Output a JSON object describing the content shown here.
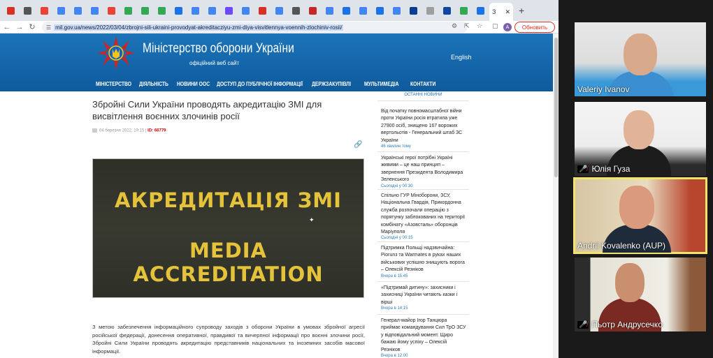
{
  "browser": {
    "active_tab_label": "З",
    "url": "mil.gov.ua/news/2022/03/04/zbrojni-sili-ukraini-provodyat-akreditacziyu-zmi-diya-visvitlennya-voennih-zlochiniv-rosii/",
    "update_button": "Обновить",
    "profile_letter": "A",
    "tab_favicons": [
      "#d93025",
      "#555",
      "#ea4335",
      "#4285f4",
      "#4285f4",
      "#4285f4",
      "#ea4335",
      "#34a853",
      "#34a853",
      "#34a853",
      "#1a73e8",
      "#4285f4",
      "#4285f4",
      "#6d4aff",
      "#4285f4",
      "#d93025",
      "#4285f4",
      "#555",
      "#c62828",
      "#4285f4",
      "#1a73e8",
      "#4285f4",
      "#1a73e8",
      "#4285f4",
      "#0b3d91",
      "#9e9e9e",
      "#0d47a1",
      "#34a853",
      "#1a73e8"
    ]
  },
  "site": {
    "title": "Міністерство оборони України",
    "subtitle": "офіційний веб сайт",
    "language": "English",
    "nav": [
      "МІНІСТЕРСТВО",
      "ДІЯЛЬНІСТЬ",
      "НОВИНИ ООС",
      "ДОСТУП ДО ПУБЛІЧНОЇ ІНФОРМАЦІЇ",
      "ДЕРЖЗАКУПІВЛІ",
      "МУЛЬТИМЕДІА",
      "КОНТАКТИ"
    ]
  },
  "article": {
    "title": "Збройні Сили України проводять акредитацію ЗМІ для висвітлення воєнних злочинів росії",
    "date": "04 березня 2022, 19:15",
    "id_label": "ID: 66779",
    "hero_line1": "АКРЕДИТАЦІЯ ЗМІ",
    "hero_line2": "MEDIA ACCREDITATION",
    "body": "З метою забезпечення інформаційного супроводу заходів з оборони України в умовах збройної агресії російської федерації, донесення оперативної, правдивої та вичерпної інформації про воєнні злочини росії, Збройні Сили України проводять акредитацію представників національних та іноземних засобів масової інформації."
  },
  "news": {
    "header": "ОСТАННІ НОВИНИ",
    "items": [
      {
        "title": "Від початку повномасштабної війни проти України росія втратила уже 27900 осіб, знищено 167 ворожих вертольотів - Генеральний штаб ЗС України",
        "time": "46 хвилин тому"
      },
      {
        "title": "Українські герої потрібні Україні живими – це наш принцип – звернення Президента Володимира Зеленського",
        "time": "Сьогодні у 00:30"
      },
      {
        "title": "Спільно ГУР Міноборони, ЗСУ, Національна Гвардія, Прикордонна служба розпочали операцію з порятунку заблокованих на території комбінату «Азовсталь» оборонців Маріуполя",
        "time": "Сьогодні у 00:15"
      },
      {
        "title": "Підтримка Польщі надзвичайна: Piorunз та Warmates в руках наших військових успішно знищують ворога – Олексій Резніков",
        "time": "Вчора в 15:45"
      },
      {
        "title": "«Підтримай дитину»: захисники і захисниці України читають казки і вірші",
        "time": "Вчора в 14:15"
      },
      {
        "title": "Генерал-майор Ігор Танцюра приймає командування Сил ТрО ЗСУ у відповідальний момент. Щиро бажаю йому успіху – Олексій Резніков",
        "time": "Вчора в 12:00"
      }
    ]
  },
  "participants": [
    {
      "name": "Valeriy Ivanov",
      "muted": false,
      "active": false
    },
    {
      "name": "Юлія Гуза",
      "muted": true,
      "active": false
    },
    {
      "name": "Andrii Kovalenko (AUP)",
      "muted": false,
      "active": true
    },
    {
      "name": "Пьотр Андрусечко",
      "muted": true,
      "active": false
    }
  ]
}
